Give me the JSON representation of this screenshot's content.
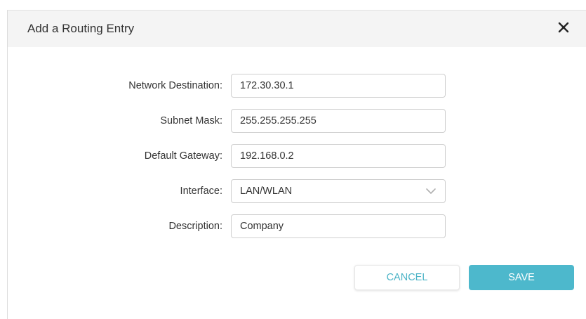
{
  "dialog": {
    "title": "Add a Routing Entry",
    "close_icon": "close-icon"
  },
  "form": {
    "network_destination": {
      "label": "Network Destination:",
      "value": "172.30.30.1"
    },
    "subnet_mask": {
      "label": "Subnet Mask:",
      "value": "255.255.255.255"
    },
    "default_gateway": {
      "label": "Default Gateway:",
      "value": "192.168.0.2"
    },
    "interface": {
      "label": "Interface:",
      "selected": "LAN/WLAN",
      "icon": "chevron-down-icon"
    },
    "description": {
      "label": "Description:",
      "value": "Company"
    }
  },
  "actions": {
    "cancel_label": "CANCEL",
    "save_label": "SAVE"
  },
  "colors": {
    "accent": "#4db8cc",
    "header_bg": "#f4f4f4",
    "text": "#333333"
  }
}
